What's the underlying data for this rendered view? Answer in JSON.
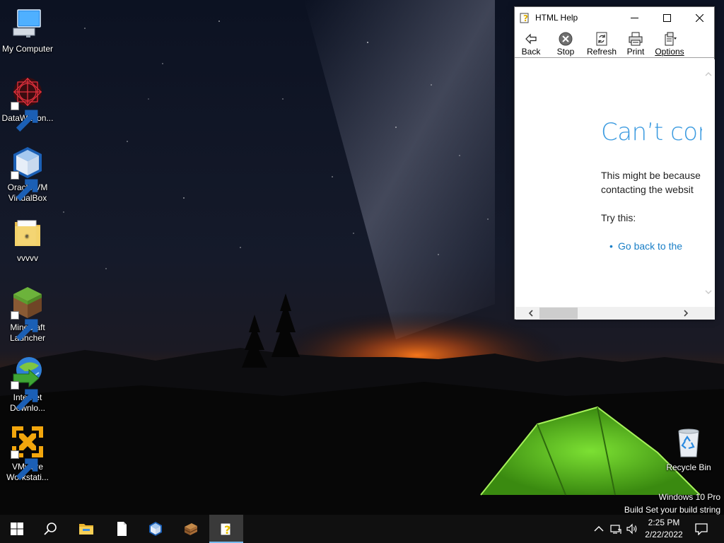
{
  "desktop": {
    "icons": [
      {
        "label": "My Computer",
        "icon": "computer-icon",
        "shortcut": false
      },
      {
        "label": "DataWagon...",
        "icon": "datawagon-icon",
        "shortcut": true
      },
      {
        "label": "Oracle VM\nVirtualBox",
        "icon": "virtualbox-icon",
        "shortcut": true
      },
      {
        "label": "vvvvv",
        "icon": "folder-icon",
        "shortcut": false
      },
      {
        "label": "Minecraft\nLauncher",
        "icon": "minecraft-icon",
        "shortcut": true
      },
      {
        "label": "Internet\nDownlo...",
        "icon": "internet-download-manager-icon",
        "shortcut": true
      },
      {
        "label": "VMware\nWorkstati...",
        "icon": "vmware-icon",
        "shortcut": true
      }
    ],
    "recycle_bin": {
      "label": "Recycle Bin",
      "icon": "recycle-bin-icon"
    }
  },
  "help_window": {
    "title": "HTML Help",
    "toolbar": {
      "back": "Back",
      "stop": "Stop",
      "refresh": "Refresh",
      "print": "Print",
      "options": "Options"
    },
    "content": {
      "title": "Can’t con",
      "line1": "This might be because",
      "line2": "contacting the websit",
      "try": "Try this:",
      "link": "Go back to the"
    },
    "colors": {
      "title": "#3c9be0",
      "link": "#1a7fc7"
    }
  },
  "watermark": {
    "line1": "Windows 10 Pro",
    "line2": "Build Set your build string"
  },
  "taskbar": {
    "items": [
      "start-button",
      "search-icon",
      "file-explorer-icon",
      "notepad-icon",
      "virtualbox-icon",
      "archive-icon",
      "html-help-icon"
    ],
    "active": "html-help-icon",
    "clock": {
      "time": "2:25 PM",
      "date": "2/22/2022"
    },
    "tray": [
      "chevron-up-icon",
      "network-icon",
      "volume-icon",
      "notification-icon"
    ],
    "accent": "#76b9ed"
  }
}
